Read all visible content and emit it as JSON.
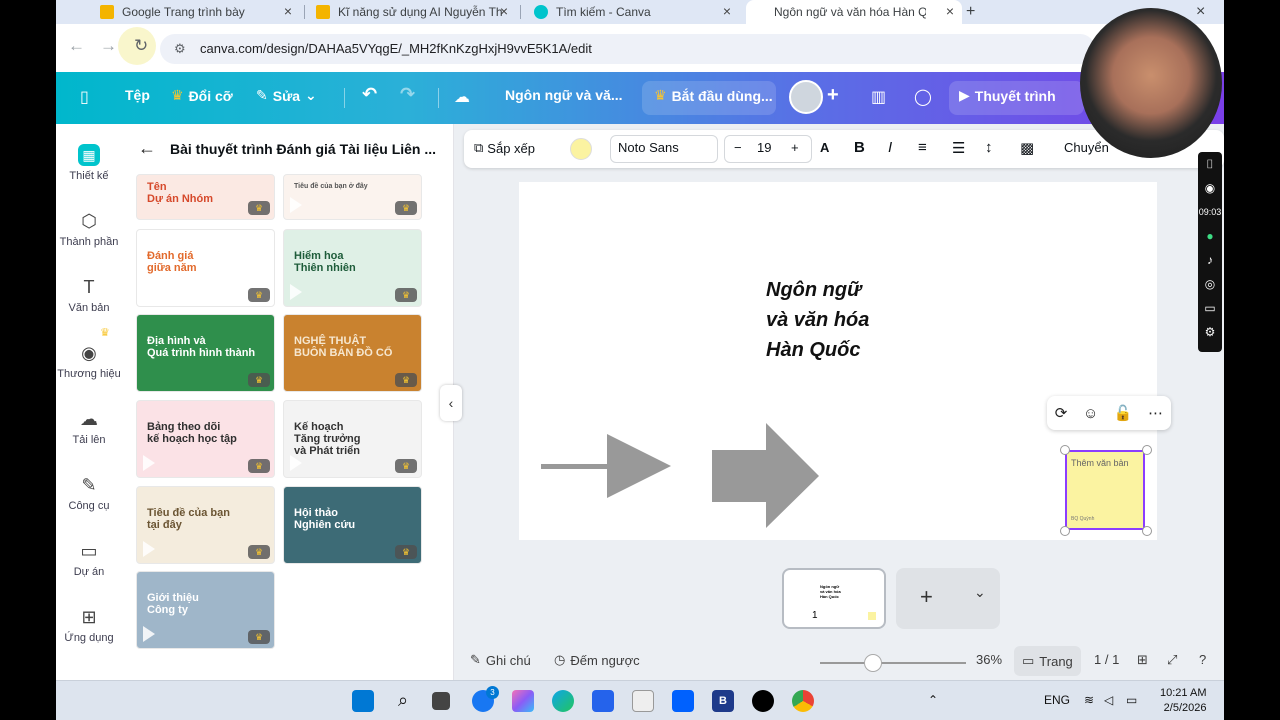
{
  "browser": {
    "tabs": [
      {
        "title": "Google Trang trình bày",
        "color": "#f4b400"
      },
      {
        "title": "Kĩ năng sử dụng AI Nguyễn Thị",
        "color": "#f4b400"
      },
      {
        "title": "Tìm kiếm - Canva",
        "color": "#00c4cc"
      },
      {
        "title": "Ngôn ngữ và văn hóa Hàn Quốc",
        "color": "#ffffff"
      }
    ],
    "new_tab": "+",
    "url": "canva.com/design/DAHAa5VYqgE/_MH2fKnKzgHxjH9vvE5K1A/edit"
  },
  "header": {
    "file": "Tệp",
    "resize": "Đổi cỡ",
    "edit": "Sửa",
    "doc_title": "Ngôn ngữ và vă...",
    "trial": "Bắt đầu dùng...",
    "present": "Thuyết trình"
  },
  "rail": [
    {
      "label": "Thiết kế",
      "icon": "design-icon"
    },
    {
      "label": "Thành phần",
      "icon": "elements-icon"
    },
    {
      "label": "Văn bản",
      "icon": "text-icon"
    },
    {
      "label": "Thương hiệu",
      "icon": "brand-icon"
    },
    {
      "label": "Tải lên",
      "icon": "upload-icon"
    },
    {
      "label": "Công cụ",
      "icon": "tools-icon"
    },
    {
      "label": "Dự án",
      "icon": "projects-icon"
    },
    {
      "label": "Ứng dụng",
      "icon": "apps-icon"
    }
  ],
  "panel": {
    "title": "Bài thuyết trình Đánh giá Tài liệu Liên ...",
    "templates": [
      {
        "text": "Tên\nDự án Nhóm",
        "bg": "#fbe9e3",
        "fg": "#d6492b"
      },
      {
        "text": "Tiêu đề của bạn ở đây",
        "bg": "#fbf3ee",
        "fg": "#555"
      },
      {
        "text": "Đánh giá\ngiữa năm",
        "bg": "#ffffff",
        "fg": "#e26a2c"
      },
      {
        "text": "Hiểm họa\nThiên nhiên",
        "bg": "#dff0e6",
        "fg": "#1e5c3a"
      },
      {
        "text": "Địa hình và\nQuá trình hình thành",
        "bg": "#2f8f4c",
        "fg": "#ffffff"
      },
      {
        "text": "NGHỆ THUẬT\nBUÔN BÁN ĐỒ CỔ",
        "bg": "#c9822f",
        "fg": "#f6e7cf"
      },
      {
        "text": "Bảng theo dõi\nkế hoạch học tập",
        "bg": "#fbe2e6",
        "fg": "#2f2f2f"
      },
      {
        "text": "Kế hoạch\nTăng trưởng\nvà Phát triển",
        "bg": "#f3f3f3",
        "fg": "#333"
      },
      {
        "text": "Tiêu đề của bạn\ntại đây",
        "bg": "#f4ecdd",
        "fg": "#6b5533"
      },
      {
        "text": "Hội thảo\nNghiên cứu",
        "bg": "#3d6b76",
        "fg": "#ffffff"
      },
      {
        "text": "Giới thiệu\nCông ty",
        "bg": "#9fb6c9",
        "fg": "#ffffff"
      }
    ]
  },
  "toolbar": {
    "arrange": "Sắp xếp",
    "font": "Noto Sans",
    "minus": "−",
    "size": "19",
    "plus": "+",
    "convert": "Chuyển"
  },
  "slide": {
    "title_lines": [
      "Ngôn ngữ",
      "và văn hóa",
      "Hàn Quốc"
    ],
    "sticky_placeholder": "Thêm văn bản",
    "sticky_author": "BQ Quỳnh",
    "page_badge": "1"
  },
  "footer": {
    "notes": "Ghi chú",
    "timer": "Đếm ngược",
    "zoom": "36%",
    "pages": "Trang",
    "page_count": "1 / 1"
  },
  "recorder": {
    "time": "09:03"
  },
  "taskbar": {
    "lang": "ENG",
    "time": "10:21 AM",
    "date": "2/5/2026",
    "badge": "3"
  }
}
